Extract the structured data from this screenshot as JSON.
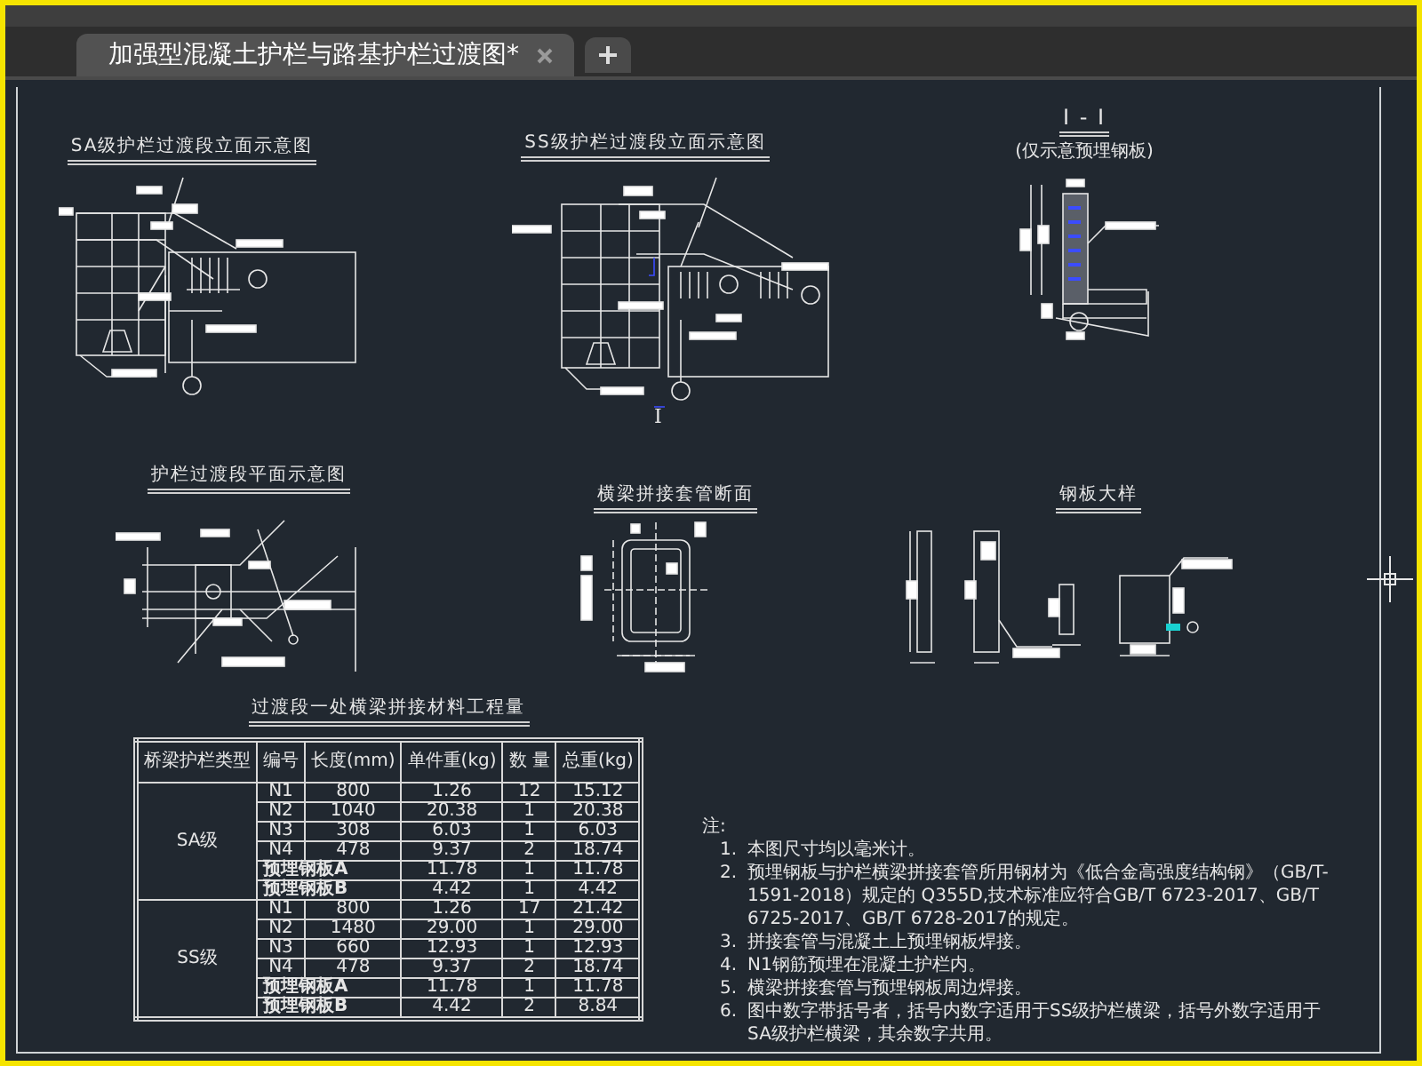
{
  "tabs": [
    {
      "title": "加强型混凝土护栏与路基护栏过渡图*",
      "selected": true
    }
  ],
  "figures": [
    {
      "kind": "sa_elevation",
      "title": "SA级护栏过渡段立面示意图"
    },
    {
      "kind": "ss_elevation",
      "title": "SS级护栏过渡段立面示意图",
      "section_label": "I"
    },
    {
      "kind": "section_ii",
      "title": "I - I",
      "subtitle": "(仅示意预埋钢板)"
    },
    {
      "kind": "plan",
      "title": "护栏过渡段平面示意图"
    },
    {
      "kind": "sleeve_section",
      "title": "横梁拼接套管断面"
    },
    {
      "kind": "plate_detail",
      "title": "钢板大样"
    }
  ],
  "table": {
    "title": "过渡段一处横梁拼接材料工程量",
    "columns": [
      "桥梁护栏类型",
      "编号",
      "长度(mm)",
      "单件重(kg)",
      "数 量",
      "总重(kg)"
    ],
    "groups": [
      {
        "type": "SA级",
        "rows": [
          {
            "kind": "bar",
            "code": "N1",
            "length": "800",
            "unit_weight": "1.26",
            "count": "12",
            "total": "15.12"
          },
          {
            "kind": "bar",
            "code": "N2",
            "length": "1040",
            "unit_weight": "20.38",
            "count": "1",
            "total": "20.38"
          },
          {
            "kind": "bar",
            "code": "N3",
            "length": "308",
            "unit_weight": "6.03",
            "count": "1",
            "total": "6.03"
          },
          {
            "kind": "bar",
            "code": "N4",
            "length": "478",
            "unit_weight": "9.37",
            "count": "2",
            "total": "18.74"
          },
          {
            "kind": "plate",
            "code": "预埋钢板A",
            "unit_weight": "11.78",
            "count": "1",
            "total": "11.78"
          },
          {
            "kind": "plate",
            "code": "预埋钢板B",
            "unit_weight": "4.42",
            "count": "1",
            "total": "4.42"
          }
        ]
      },
      {
        "type": "SS级",
        "rows": [
          {
            "kind": "bar",
            "code": "N1",
            "length": "800",
            "unit_weight": "1.26",
            "count": "17",
            "total": "21.42"
          },
          {
            "kind": "bar",
            "code": "N2",
            "length": "1480",
            "unit_weight": "29.00",
            "count": "1",
            "total": "29.00"
          },
          {
            "kind": "bar",
            "code": "N3",
            "length": "660",
            "unit_weight": "12.93",
            "count": "1",
            "total": "12.93"
          },
          {
            "kind": "bar",
            "code": "N4",
            "length": "478",
            "unit_weight": "9.37",
            "count": "2",
            "total": "18.74"
          },
          {
            "kind": "plate",
            "code": "预埋钢板A",
            "unit_weight": "11.78",
            "count": "1",
            "total": "11.78"
          },
          {
            "kind": "plate",
            "code": "预埋钢板B",
            "unit_weight": "4.42",
            "count": "2",
            "total": "8.84"
          }
        ]
      }
    ]
  },
  "notes": {
    "heading": "注:",
    "items": [
      {
        "number": "1.",
        "text": "本图尺寸均以毫米计。"
      },
      {
        "number": "2.",
        "text": "预埋钢板与护栏横梁拼接套管所用钢材为《低合金高强度结构钢》（GB/T-1591-2018）规定的 Q355D,技术标准应符合GB/T 6723-2017、GB/T 6725-2017、GB/T 6728-2017的规定。"
      },
      {
        "number": "3.",
        "text": "拼接套管与混凝土上预埋钢板焊接。"
      },
      {
        "number": "4.",
        "text": "N1钢筋预埋在混凝土护栏内。"
      },
      {
        "number": "5.",
        "text": "横梁拼接套管与预埋钢板周边焊接。"
      },
      {
        "number": "6.",
        "text": "图中数字带括号者，括号内数字适用于SS级护栏横梁，括号外数字适用于SA级护栏横梁，其余数字共用。"
      }
    ]
  }
}
